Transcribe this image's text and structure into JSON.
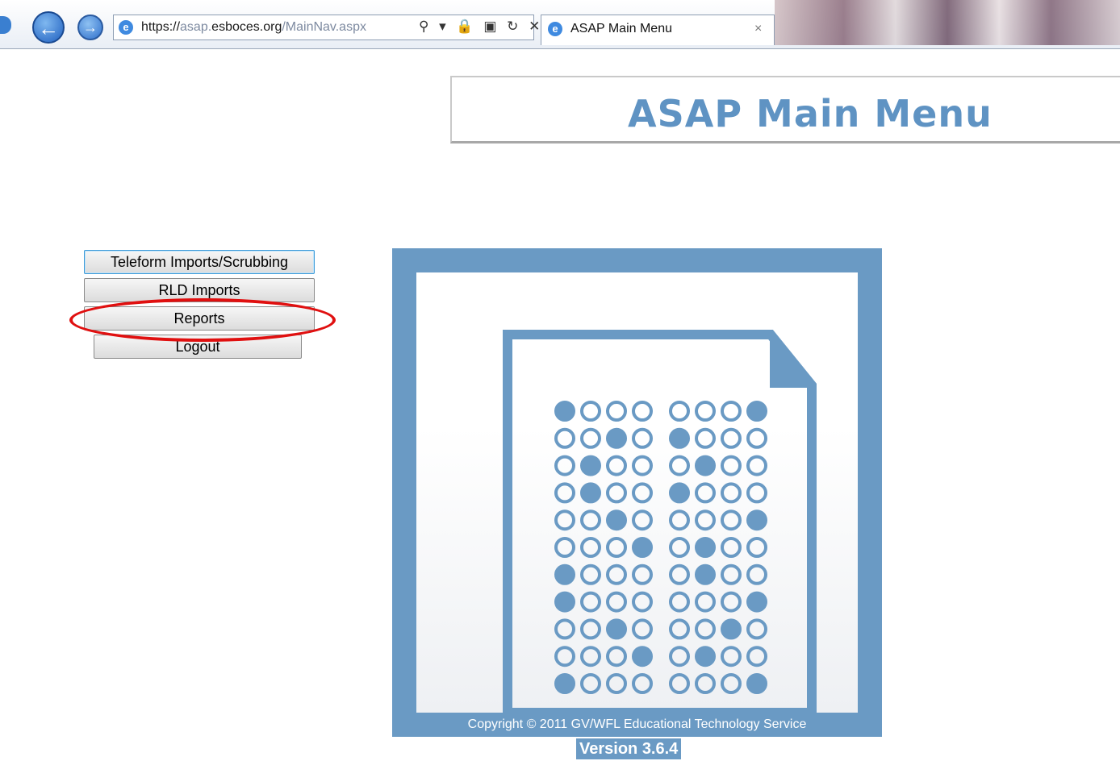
{
  "browser": {
    "url_prefix": "https://",
    "url_host_pre": "asap.",
    "url_host_main": "esboces.org",
    "url_path": "/MainNav.aspx",
    "address_icons": "⚲ ▾ 🔒 ▣ ↻ ✕",
    "tab_title": "ASAP Main Menu",
    "tab_close": "×"
  },
  "header": {
    "title": "ASAP Main Menu"
  },
  "menu": {
    "teleform": "Teleform Imports/Scrubbing",
    "rld": "RLD Imports",
    "reports": "Reports",
    "logout": "Logout"
  },
  "logo": {
    "color": "#6a9ac4",
    "bubble_rows": [
      "1000 0001",
      "0010 1000",
      "0100 0100",
      "0100 1000",
      "0010 0001",
      "0001 0100",
      "1000 0100",
      "1000 0001",
      "0010 0010",
      "0001 0100",
      "1000 0001"
    ]
  },
  "footer": {
    "copyright": "Copyright © 2011 GV/WFL Educational Technology Service",
    "version": "Version 3.6.4"
  },
  "annotation": {
    "color": "#e01010",
    "target": "reports-button"
  }
}
